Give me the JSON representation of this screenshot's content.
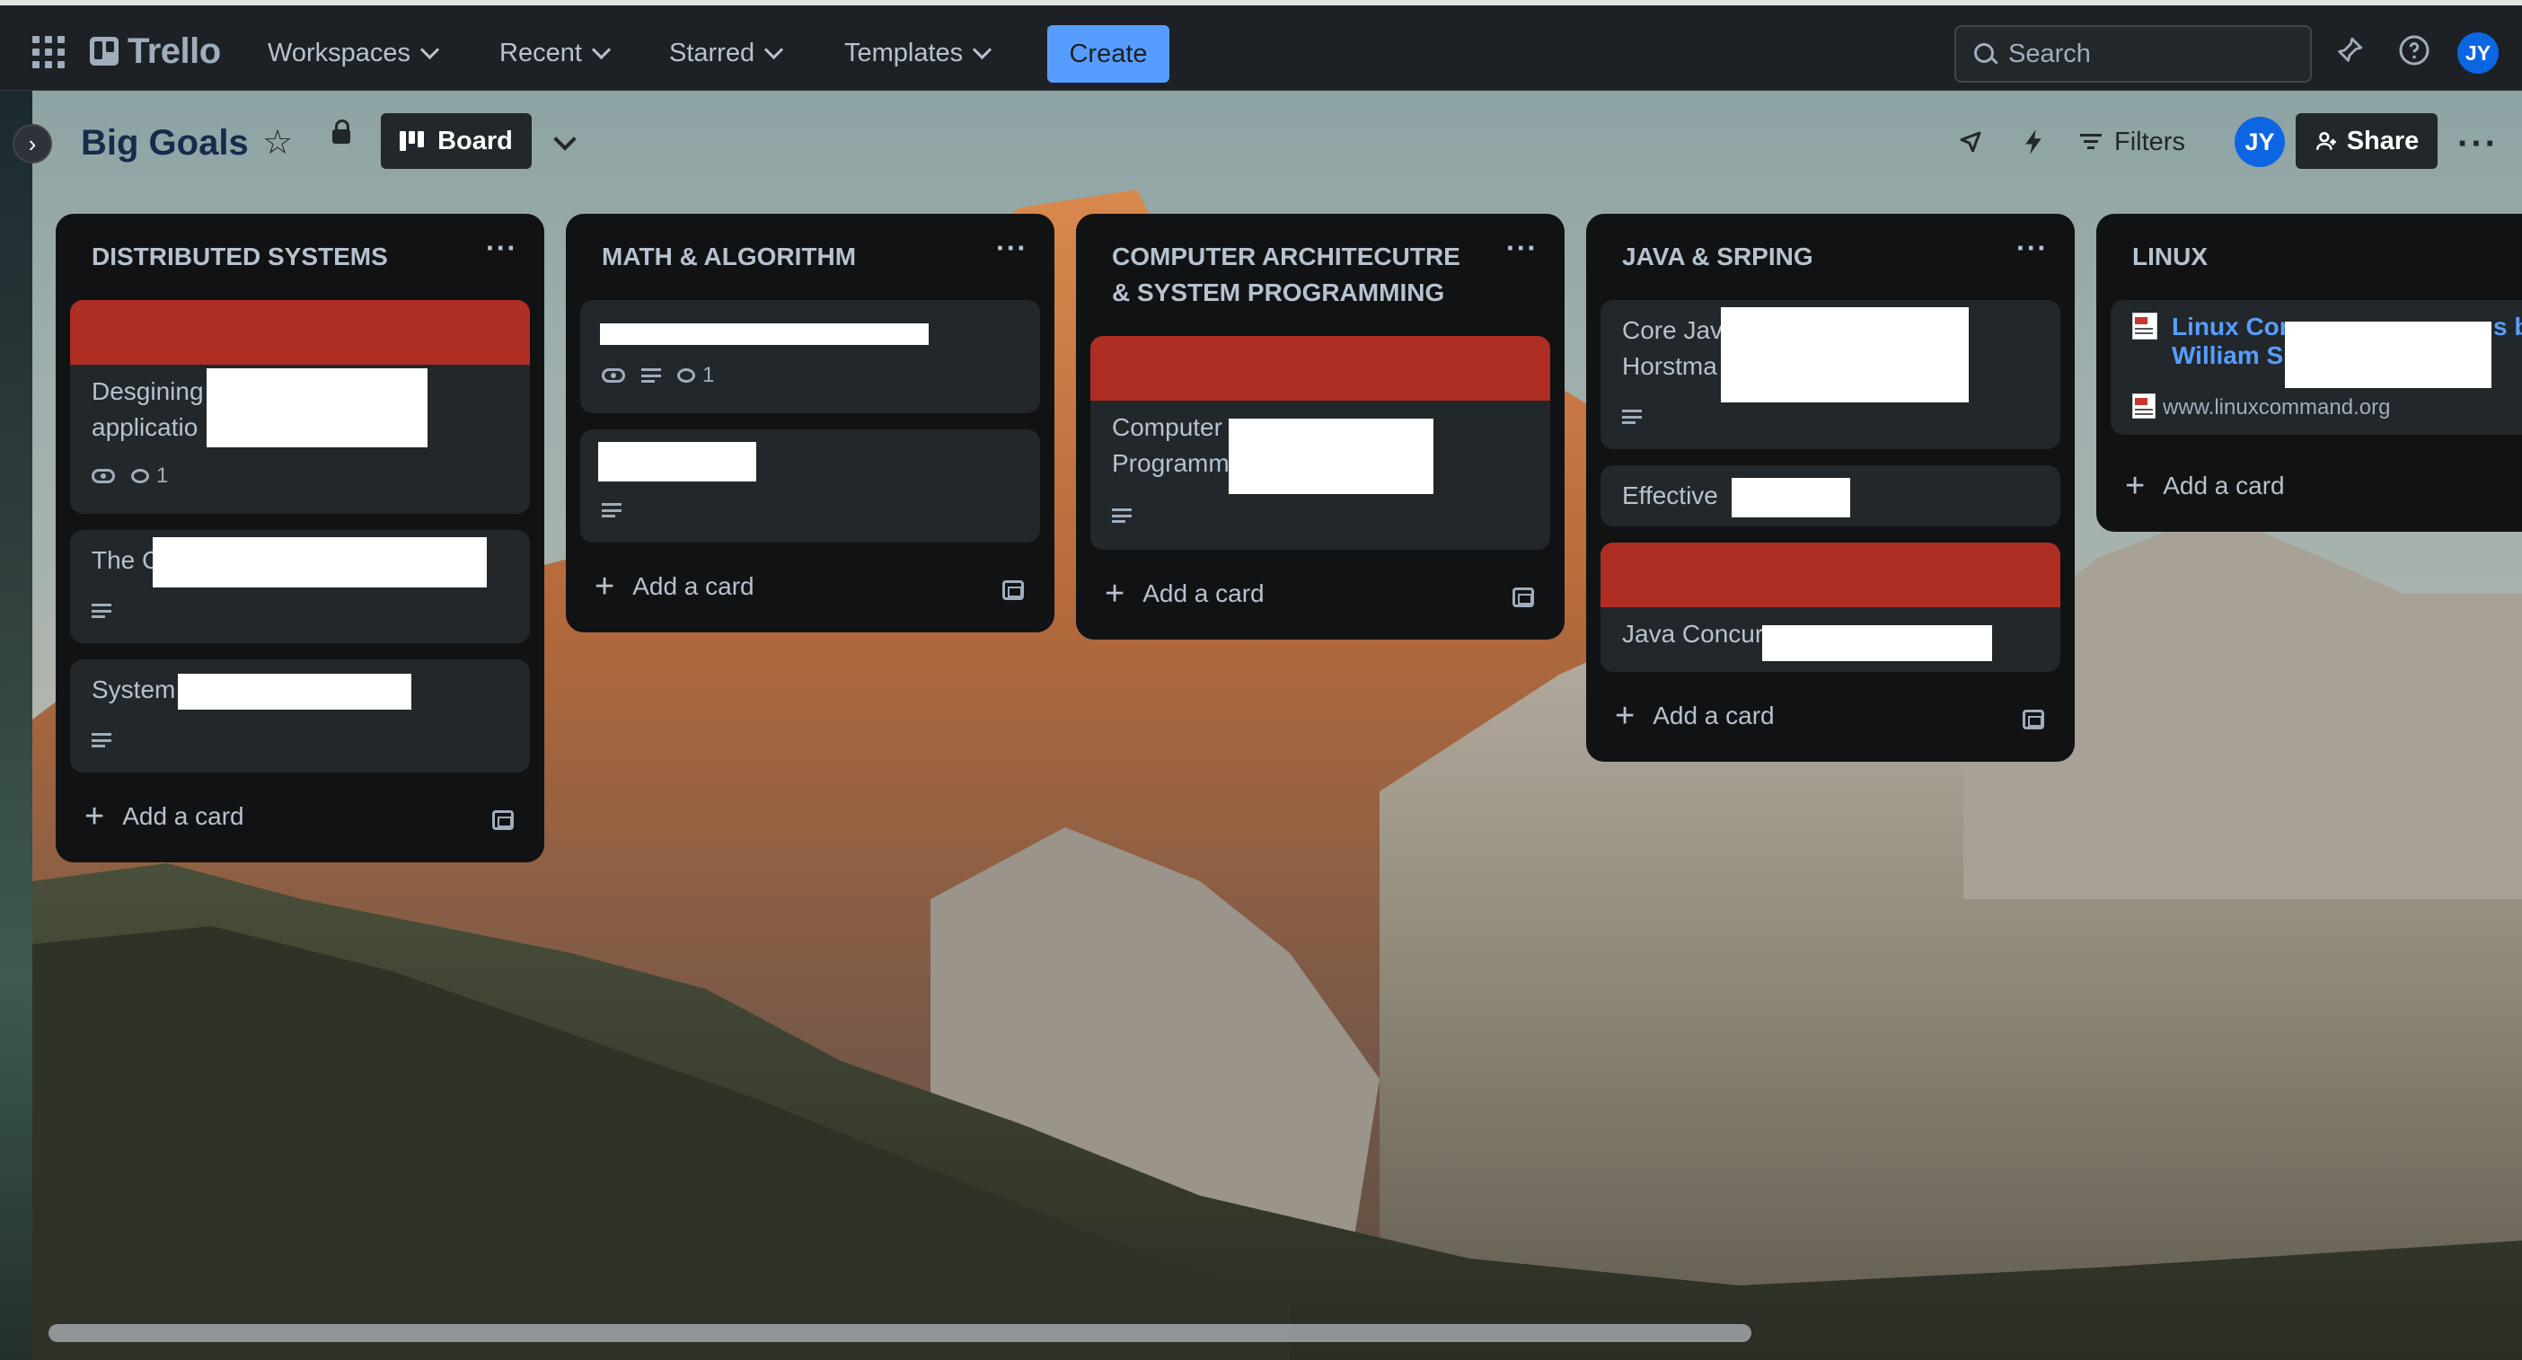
{
  "app": {
    "name": "Trello"
  },
  "topnav": {
    "menus": [
      "Workspaces",
      "Recent",
      "Starred",
      "Templates"
    ],
    "create_label": "Create",
    "search_placeholder": "Search",
    "user_initials": "JY"
  },
  "board": {
    "title": "Big Goals",
    "view_label": "Board",
    "filters_label": "Filters",
    "share_label": "Share",
    "member_initials": "JY",
    "more_label": "···"
  },
  "add_card_label": "Add a card",
  "lists": [
    {
      "title": "DISTRIBUTED SYSTEMS",
      "cards": [
        {
          "text": "Desgining\napplicatio",
          "cover": true,
          "watchers": true,
          "comments": "1"
        },
        {
          "text": "The C",
          "description": true
        },
        {
          "text": "System",
          "description": true
        }
      ]
    },
    {
      "title": "MATH & ALGORITHM",
      "cards": [
        {
          "text": "",
          "watchers": true,
          "description": true,
          "comments": "1"
        },
        {
          "text": "",
          "description": true
        }
      ]
    },
    {
      "title": "COMPUTER ARCHITECUTRE\n& SYSTEM PROGRAMMING",
      "cards": [
        {
          "text": "Computer\nProgramm",
          "cover": true,
          "description": true
        }
      ]
    },
    {
      "title": "JAVA & SRPING",
      "cards": [
        {
          "text": "Core Jav\nHorstma",
          "description": true
        },
        {
          "text": "Effective"
        },
        {
          "text": "Java Concur",
          "cover": true
        }
      ]
    },
    {
      "title": "LINUX",
      "cards": [
        {
          "link_title": "Linux Cor\nWilliam S",
          "link_title_tail": "s b",
          "url": "www.linuxcommand.org"
        }
      ]
    }
  ],
  "colors": {
    "accent": "#579dff",
    "card_cover": "#ae2e24",
    "list_bg": "#111214",
    "card_bg": "#22272b"
  }
}
